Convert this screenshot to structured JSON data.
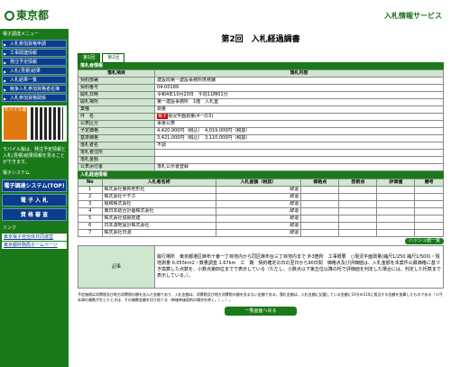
{
  "header": {
    "logo": "東京都",
    "service_title": "入札情報サービス"
  },
  "sidebar": {
    "menu_heading": "電子調達メニュー",
    "items": [
      "入札参加資格申請",
      "工事関連情報",
      "発注予定情報",
      "入札(見積)結果",
      "入札結果一覧",
      "競争入札参加資格者名簿",
      "入札参加資格関係"
    ],
    "mobile_badge": "モバイル版",
    "mobile_text": "モバイル版は、発注予定情報と入札(見積)結果情報を見ることができます。",
    "other_heading": "電子システム",
    "big_buttons": [
      "電子調達システム(TOP)",
      "電 子 入 札",
      "資 格 審 査"
    ],
    "link_heading": "リンク",
    "links": [
      "東京電子自治体共同運営",
      "東京都財務局ホームページ"
    ]
  },
  "main": {
    "page_title": "第2回　入札経過調書",
    "tabs": [
      "第1回",
      "第2回"
    ],
    "section1": "落札者情報",
    "col_item": "落札項目",
    "col_content": "落札内容",
    "rows": [
      {
        "label": "契約部署",
        "value": "建設局第一建設事務所庶務課"
      },
      {
        "label": "契約番号",
        "value": "04-00189"
      },
      {
        "label": "開札日時",
        "value": "令和4年10月20日　午前11時01分"
      },
      {
        "label": "開札場所",
        "value": "第一建設事務所　1階　入札室"
      },
      {
        "label": "業種",
        "value": "測量"
      },
      {
        "label": "件　名",
        "value": "現況平面測量(4一の3)",
        "tag": "電子"
      },
      {
        "label": "公表区分",
        "value": "事後公表"
      },
      {
        "label": "予定価格",
        "value": "4,420,900円（税込）　4,019,000円（税抜）"
      },
      {
        "label": "基準価格",
        "value": "3,421,000円（税込）　3,110,000円（税抜）"
      },
      {
        "label": "落札者名",
        "value": "不調"
      },
      {
        "label": "落札者住所",
        "value": ""
      },
      {
        "label": "落札金額",
        "value": ""
      },
      {
        "label": "公表添付書",
        "value": "落札公示書登録"
      }
    ],
    "section2": "入札経過情報",
    "bid_headers": [
      "No",
      "入札者名称",
      "入札金額（税抜）",
      "価格点",
      "技術点",
      "評価値",
      "備考"
    ],
    "bids": [
      {
        "no": "1",
        "name": "株式会社東邦地形社",
        "status": "辞退"
      },
      {
        "no": "2",
        "name": "株式会社ヤチホ",
        "status": "辞退"
      },
      {
        "no": "3",
        "name": "昭和株式会社",
        "status": "辞退"
      },
      {
        "no": "4",
        "name": "東日本総合計画株式会社",
        "status": "辞退"
      },
      {
        "no": "5",
        "name": "株式会社協振技建",
        "status": "辞退"
      },
      {
        "no": "6",
        "name": "日本測地設計株式会社",
        "status": "辞退"
      },
      {
        "no": "7",
        "name": "株式会社日測",
        "status": "辞退"
      }
    ],
    "history_button": "ハッシュ値一覧",
    "remarks_label": "記事",
    "remarks": "履行場所　東京都港区麻布十番一丁目地内から同区麻布台三丁目地内まで 外3箇所　工事概要　○現況平面測量(縮尺1/250 縮尺1/500)・現地測量 0.055km2・数量調査 1.67km　工　期　契約確定の日の翌日から90日間　価格点及び評価値は、入札金額を本案件公募価格に基づき換算した点数を、小数点第四位までで表示している（ただし、小数点以下第五位以降の桁で評価値を判定した場合には、判定した桁数まで表示している。）。",
    "footer_note": "予定価格は消費税及び地方消費税の額を含んだ金額であり、入札金額は、消費税及び地方消費税の額を含まない金額である。落札金額は、入札金額に記載している金額に10分の110に相当する金額を加算したものである（１円未満の端数が生じたときは、その端数金額を切り捨てる（単価単価契約の場合を除く。）。）。",
    "back_button": "一覧画面へ戻る"
  },
  "colors": {
    "brand_green": "#1a7a1a",
    "nav_blue": "#0a3d8a"
  }
}
